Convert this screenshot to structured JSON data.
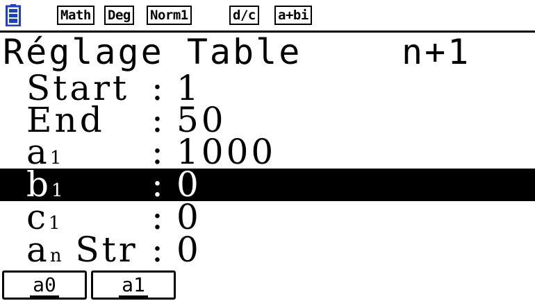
{
  "status_bar": {
    "battery_icon": "battery-icon",
    "badges": [
      "Math",
      "Deg",
      "Norm1",
      "d/c",
      "a+bi"
    ]
  },
  "title": {
    "main": "Réglage Table",
    "right": "n+1"
  },
  "rows": [
    {
      "label": "Start",
      "sub": "",
      "colon": ":",
      "value": "1",
      "selected": false
    },
    {
      "label": "End",
      "sub": "",
      "colon": ":",
      "value": "50",
      "selected": false
    },
    {
      "label": "a",
      "sub": "1",
      "colon": ":",
      "value": "1000",
      "selected": false
    },
    {
      "label": "b",
      "sub": "1",
      "colon": ":",
      "value": "0",
      "selected": true
    },
    {
      "label": "c",
      "sub": "1",
      "colon": ":",
      "value": "0",
      "selected": false
    },
    {
      "label": "a",
      "sub": "n",
      "label_suffix": " Str",
      "colon": ":",
      "value": "0",
      "selected": false
    }
  ],
  "function_keys": [
    "a0",
    "a1"
  ],
  "colors": {
    "background": "#ffffff",
    "foreground": "#000000",
    "battery_blue": "#1a3fd6"
  }
}
